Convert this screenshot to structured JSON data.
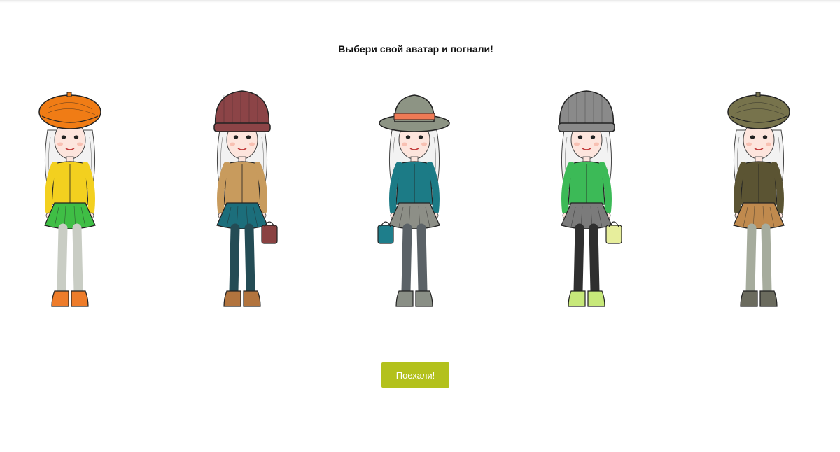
{
  "heading": "Выбери свой аватар и погнали!",
  "go_button_label": "Поехали!",
  "colors": {
    "button_bg": "#b3c11c",
    "button_text": "#ffffff",
    "heading_text": "#111111",
    "skin": "#fde5dd",
    "hair": "#f2f2f2"
  },
  "avatars": [
    {
      "name": "avatar-1",
      "hat": "beret",
      "hat_color": "#f07c15",
      "top_color": "#f3d01f",
      "bottom_color": "#3fbe45",
      "legs_color": "#c9cdc4",
      "shoes_color": "#ee7c2a",
      "bag": "none"
    },
    {
      "name": "avatar-2",
      "hat": "beanie",
      "hat_color": "#8c4447",
      "top_color": "#c89b5d",
      "bottom_color": "#1c6e7b",
      "legs_color": "#244c55",
      "shoes_color": "#b2743e",
      "bag": "#8a4242"
    },
    {
      "name": "avatar-3",
      "hat": "fedora",
      "hat_color": "#8d9484",
      "top_color": "#1c7b86",
      "bottom_color": "#8d8f87",
      "legs_color": "#5b6267",
      "shoes_color": "#8a8f86",
      "bag": "#1e7e8b"
    },
    {
      "name": "avatar-4",
      "hat": "beanie",
      "hat_color": "#8a8a8a",
      "top_color": "#3cba57",
      "bottom_color": "#7b7b7b",
      "legs_color": "#2f2f2f",
      "shoes_color": "#c7e87a",
      "bag": "#e7ee9c"
    },
    {
      "name": "avatar-5",
      "hat": "beret",
      "hat_color": "#77734c",
      "top_color": "#5b5433",
      "bottom_color": "#c08a4e",
      "legs_color": "#a6ac9d",
      "shoes_color": "#6b6b5e",
      "bag": "none"
    }
  ]
}
